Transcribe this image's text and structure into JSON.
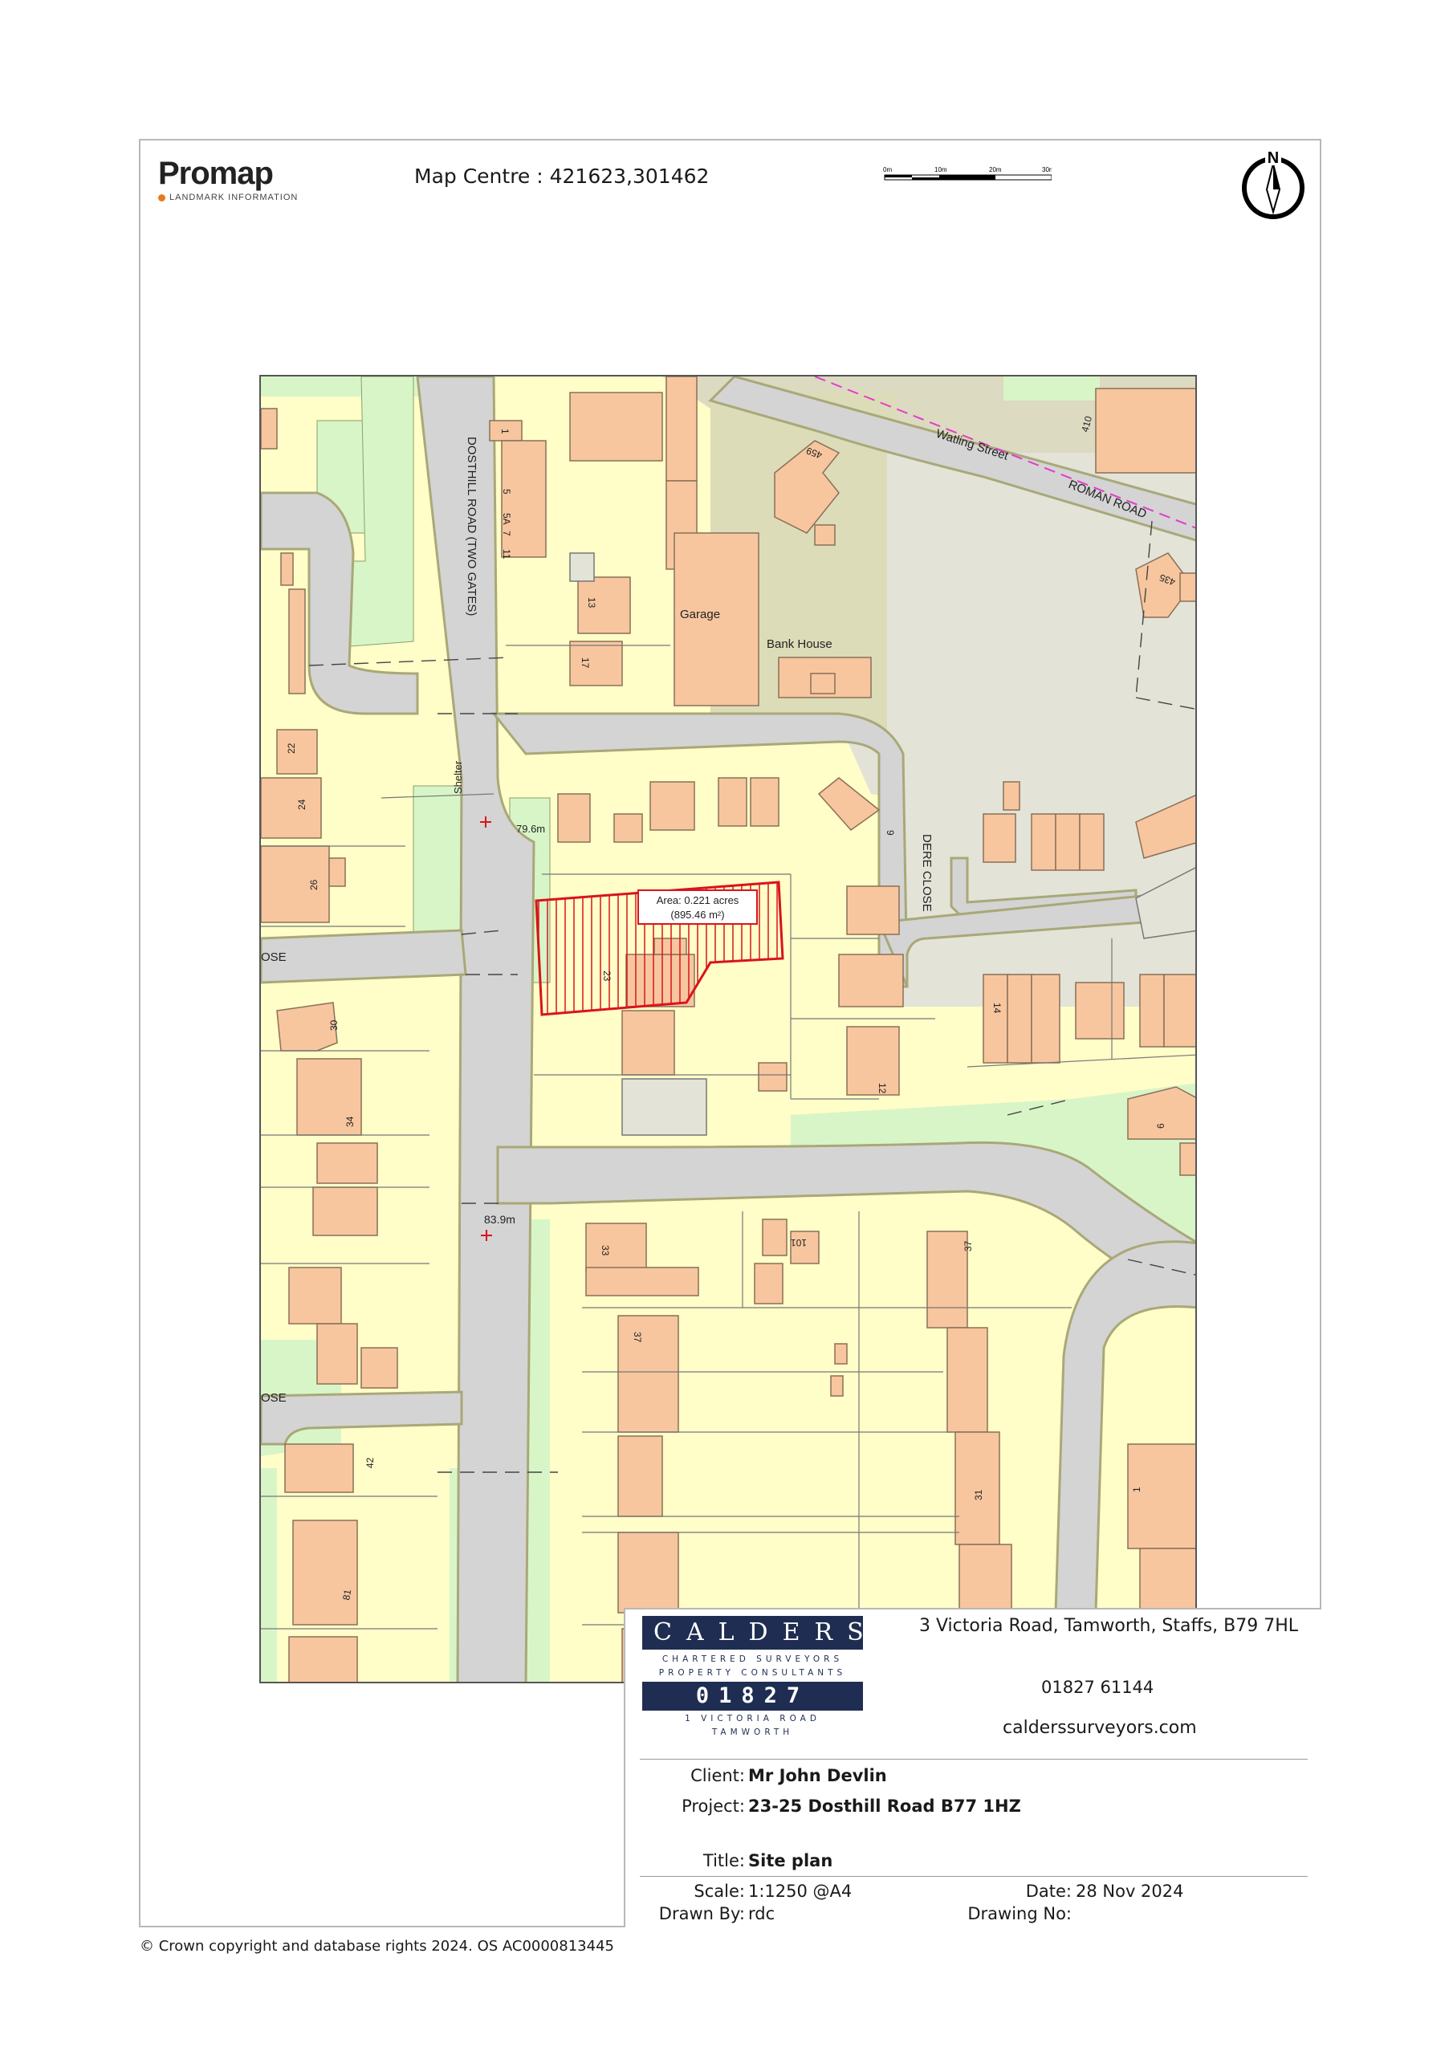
{
  "header": {
    "brand_name": "Promap",
    "brand_sub": "LANDMARK INFORMATION",
    "map_centre": "Map Centre : 421623,301462",
    "scale_labels": [
      "0m",
      "10m",
      "20m",
      "30m"
    ],
    "north_label": "N"
  },
  "map": {
    "roads": {
      "dosthill": "DOSTHILL ROAD (TWO GATES)",
      "watling": "Watling Street",
      "roman": "ROMAN ROAD",
      "dere": "DERE CLOSE",
      "close_a": "OSE",
      "close_b": "OSE"
    },
    "labels": {
      "garage": "Garage",
      "bank_house": "Bank House",
      "shelter": "Shelter",
      "spot1": "79.6m",
      "spot2": "83.9m"
    },
    "area_box": {
      "line1": "Area: 0.221 acres",
      "line2": "(895.46 m²)"
    },
    "house_numbers": {
      "n1": "1",
      "n5": "5",
      "n5a": "5A",
      "n7": "7",
      "n11": "11",
      "n13": "13",
      "n17": "17",
      "n459": "459",
      "n410": "410",
      "n435": "435",
      "n22": "22",
      "n24": "24",
      "n26": "26",
      "n30": "30",
      "n34": "34",
      "n23": "23",
      "n6": "6",
      "n12": "12",
      "n14": "14",
      "n9": "9",
      "n33": "33",
      "n101": "101",
      "n37a": "37",
      "n37b": "37",
      "n42": "42",
      "n81": "81",
      "n31": "31",
      "n1b": "1"
    }
  },
  "title_block": {
    "company": "CALDERS",
    "tagline1": "CHARTERED SURVEYORS",
    "tagline2": "PROPERTY CONSULTANTS",
    "logo_phone": "01827 61144",
    "logo_address": "1 VICTORIA ROAD TAMWORTH",
    "address": "3 Victoria Road, Tamworth, Staffs, B79 7HL",
    "phone": "01827 61144",
    "website": "calderssurveyors.com",
    "client_label": "Client:",
    "client_value": "Mr John Devlin",
    "project_label": "Project:",
    "project_value": "23-25 Dosthill Road B77 1HZ",
    "title_label": "Title:",
    "title_value": "Site plan",
    "scale_label": "Scale:",
    "scale_value": "1:1250 @A4",
    "date_label": "Date:",
    "date_value": "28 Nov 2024",
    "drawn_label": "Drawn By:",
    "drawn_value": "rdc",
    "drawing_no_label": "Drawing No:",
    "drawing_no_value": ""
  },
  "footer": {
    "copyright": "© Crown copyright and database rights 2024. OS AC0000813445"
  },
  "colors": {
    "plot": "#fffdc8",
    "building": "#f7c69f",
    "green": "#d8f5c8",
    "road": "#d4d4d4",
    "road_edge": "#bab98a",
    "site_boundary": "#d9141b",
    "calders_navy": "#1f2d52"
  }
}
